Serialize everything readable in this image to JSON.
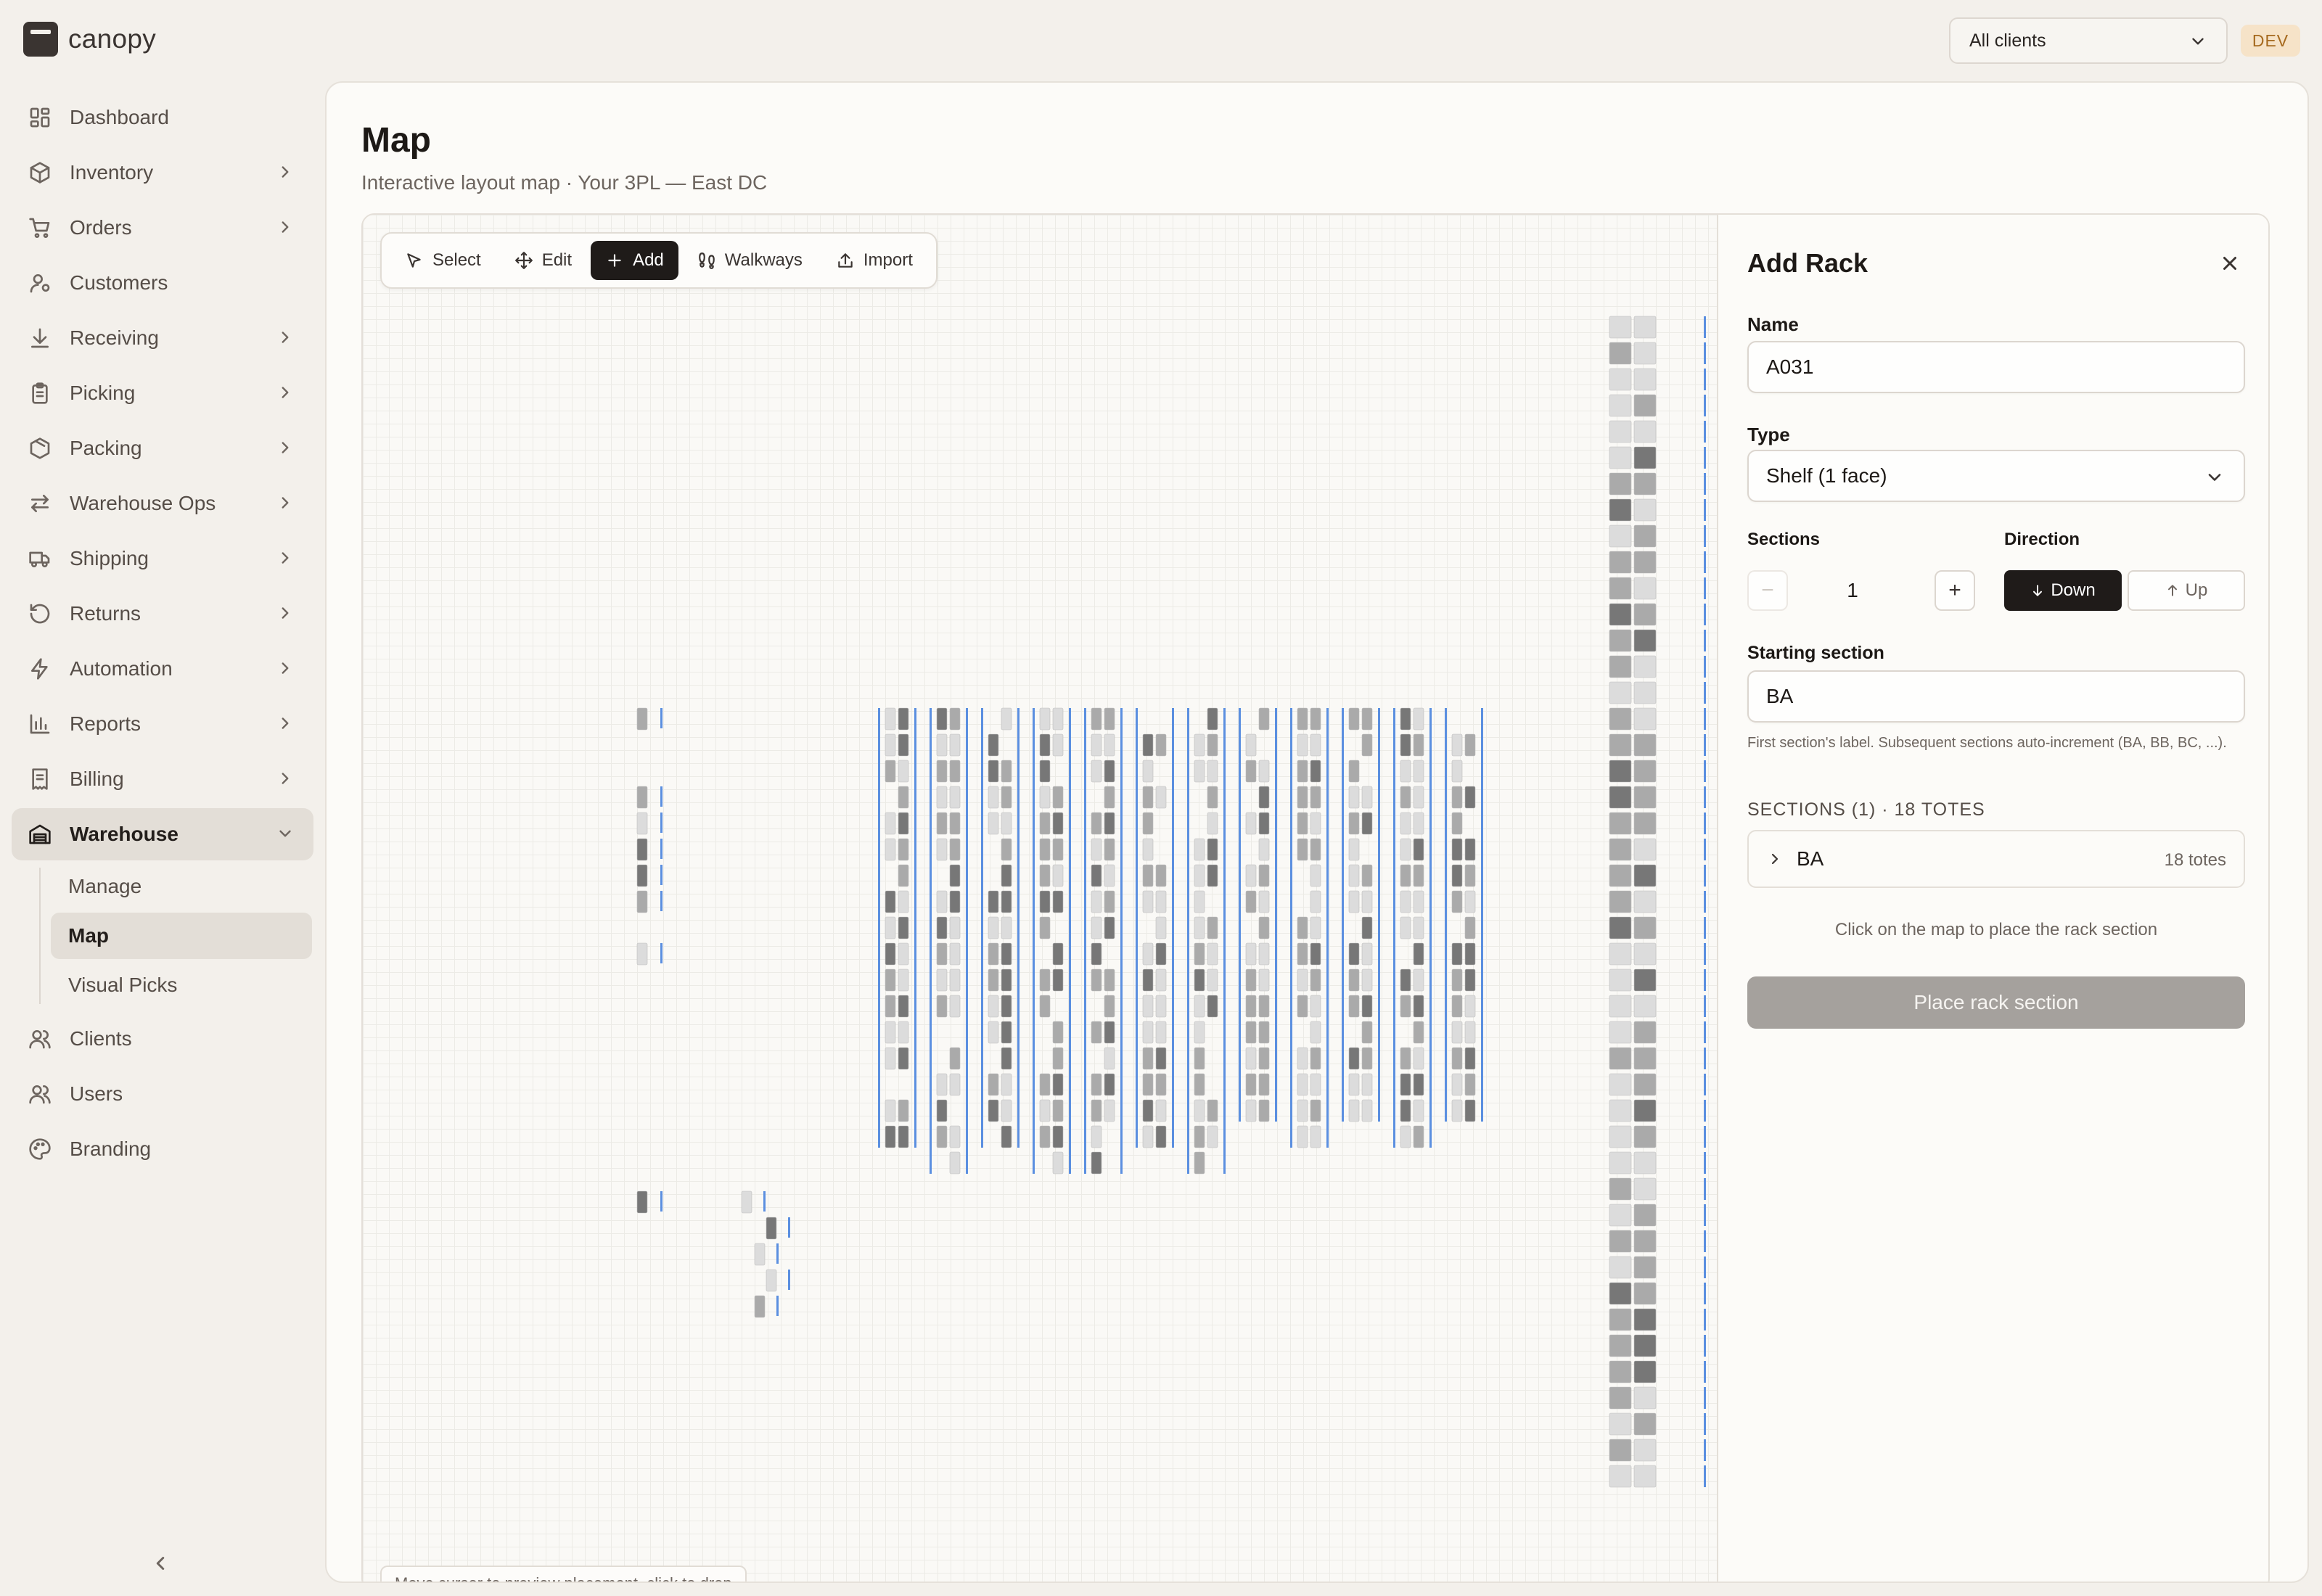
{
  "app": {
    "logo_text": "canopy"
  },
  "header": {
    "client_select": "All clients",
    "env_badge": "DEV"
  },
  "sidebar": {
    "items": [
      {
        "label": "Dashboard",
        "icon": "dashboard-icon",
        "has_children": false
      },
      {
        "label": "Inventory",
        "icon": "box-icon",
        "has_children": true
      },
      {
        "label": "Orders",
        "icon": "cart-icon",
        "has_children": true
      },
      {
        "label": "Customers",
        "icon": "customer-icon",
        "has_children": false
      },
      {
        "label": "Receiving",
        "icon": "download-icon",
        "has_children": true
      },
      {
        "label": "Picking",
        "icon": "clipboard-icon",
        "has_children": true
      },
      {
        "label": "Packing",
        "icon": "package-icon",
        "has_children": true
      },
      {
        "label": "Warehouse Ops",
        "icon": "arrows-swap-icon",
        "has_children": true
      },
      {
        "label": "Shipping",
        "icon": "truck-icon",
        "has_children": true
      },
      {
        "label": "Returns",
        "icon": "rotate-icon",
        "has_children": true
      },
      {
        "label": "Automation",
        "icon": "bolt-icon",
        "has_children": true
      },
      {
        "label": "Reports",
        "icon": "bar-chart-icon",
        "has_children": true
      },
      {
        "label": "Billing",
        "icon": "receipt-icon",
        "has_children": true
      },
      {
        "label": "Warehouse",
        "icon": "warehouse-icon",
        "has_children": true,
        "expanded": true
      }
    ],
    "warehouse_sub": [
      "Manage",
      "Map",
      "Visual Picks"
    ],
    "active_sub": "Map",
    "bottom_items": [
      {
        "label": "Clients",
        "icon": "clients-icon"
      },
      {
        "label": "Users",
        "icon": "users-icon"
      },
      {
        "label": "Branding",
        "icon": "palette-icon"
      }
    ]
  },
  "page": {
    "title": "Map",
    "subtitle": "Interactive layout map · Your 3PL — East DC"
  },
  "toolbar": {
    "select": "Select",
    "edit": "Edit",
    "add": "Add",
    "walkways": "Walkways",
    "import": "Import",
    "active": "Add"
  },
  "map": {
    "hint": "Move cursor to preview placement, click to drop"
  },
  "panel": {
    "title": "Add Rack",
    "name_label": "Name",
    "name_value": "A031",
    "type_label": "Type",
    "type_value": "Shelf (1 face)",
    "sections_label": "Sections",
    "sections_value": "1",
    "direction_label": "Direction",
    "direction_down": "Down",
    "direction_up": "Up",
    "direction_selected": "Down",
    "starting_label": "Starting section",
    "starting_value": "BA",
    "help_text": "First section's label. Subsequent sections auto-increment (BA, BB, BC, ...).",
    "sections_header": "SECTIONS (1) · 18 TOTES",
    "section_row": {
      "name": "BA",
      "count": "18 totes"
    },
    "place_hint": "Click on the map to place the rack section",
    "place_button": "Place rack section"
  },
  "colors": {
    "accent": "#1f1b19",
    "walkway": "#5b8fe0",
    "bin_empty": "#dcdcdc",
    "bin_medium": "#aaaaaa",
    "bin_full": "#777777",
    "dev_badge": "#f6e3c8"
  }
}
